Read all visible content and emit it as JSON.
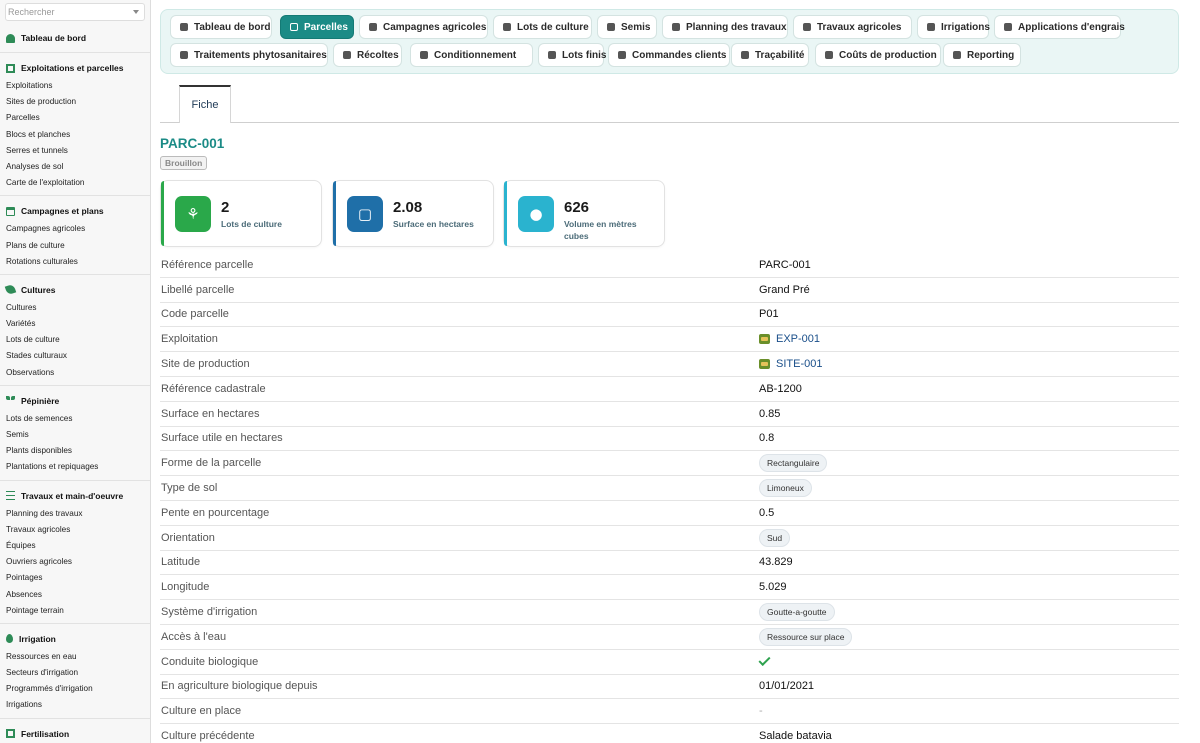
{
  "sidebar": {
    "search_placeholder": "Rechercher",
    "dashboard_label": "Tableau de bord",
    "groups": [
      {
        "title": "Exploitations et parcelles",
        "items": [
          "Exploitations",
          "Sites de production",
          "Parcelles",
          "Blocs et planches",
          "Serres et tunnels",
          "Analyses de sol",
          "Carte de l'exploitation"
        ]
      },
      {
        "title": "Campagnes et plans",
        "items": [
          "Campagnes agricoles",
          "Plans de culture",
          "Rotations culturales"
        ]
      },
      {
        "title": "Cultures",
        "items": [
          "Cultures",
          "Variétés",
          "Lots de culture",
          "Stades culturaux",
          "Observations"
        ]
      },
      {
        "title": "Pépinière",
        "items": [
          "Lots de semences",
          "Semis",
          "Plants disponibles",
          "Plantations et repiquages"
        ]
      },
      {
        "title": "Travaux et main-d'oeuvre",
        "items": [
          "Planning des travaux",
          "Travaux agricoles",
          "Équipes",
          "Ouvriers agricoles",
          "Pointages",
          "Absences",
          "Pointage terrain"
        ]
      },
      {
        "title": "Irrigation",
        "items": [
          "Ressources en eau",
          "Secteurs d'irrigation",
          "Programmés d'irrigation",
          "Irrigations"
        ]
      },
      {
        "title": "Fertilisation",
        "items": []
      }
    ]
  },
  "topnav": {
    "row1": [
      "Tableau de bord",
      "Parcelles",
      "Campagnes agricoles",
      "Lots de culture",
      "Semis",
      "Planning des travaux",
      "Travaux agricoles",
      "Irrigations",
      "Applications d'engrais"
    ],
    "row2": [
      "Traitements phytosanitaires",
      "Récoltes",
      "Conditionnement",
      "Lots finis",
      "Commandes clients",
      "Traçabilité",
      "Coûts de production",
      "Reporting"
    ],
    "active": "Parcelles"
  },
  "tab": {
    "label": "Fiche"
  },
  "record": {
    "title": "PARC-001",
    "status": "Brouillon"
  },
  "kpis": [
    {
      "value": "2",
      "label": "Lots de culture",
      "color": "#2aa84a",
      "icon": "sprout-icon"
    },
    {
      "value": "2.08",
      "label": "Surface en hectares",
      "color": "#1f6fa8",
      "icon": "area-icon"
    },
    {
      "value": "626",
      "label": "Volume en mètres cubes",
      "color": "#2ab3cf",
      "icon": "water-drop-icon"
    }
  ],
  "details": [
    {
      "key": "Référence parcelle",
      "value": "PARC-001",
      "type": "text"
    },
    {
      "key": "Libellé parcelle",
      "value": "Grand Pré",
      "type": "text"
    },
    {
      "key": "Code parcelle",
      "value": "P01",
      "type": "text"
    },
    {
      "key": "Exploitation",
      "value": "EXP-001",
      "type": "link"
    },
    {
      "key": "Site de production",
      "value": "SITE-001",
      "type": "link"
    },
    {
      "key": "Référence cadastrale",
      "value": "AB-1200",
      "type": "text"
    },
    {
      "key": "Surface en hectares",
      "value": "0.85",
      "type": "text"
    },
    {
      "key": "Surface utile en hectares",
      "value": "0.8",
      "type": "text"
    },
    {
      "key": "Forme de la parcelle",
      "value": "Rectangulaire",
      "type": "chip"
    },
    {
      "key": "Type de sol",
      "value": "Limoneux",
      "type": "chip"
    },
    {
      "key": "Pente en pourcentage",
      "value": "0.5",
      "type": "text"
    },
    {
      "key": "Orientation",
      "value": "Sud",
      "type": "chip"
    },
    {
      "key": "Latitude",
      "value": "43.829",
      "type": "text"
    },
    {
      "key": "Longitude",
      "value": "5.029",
      "type": "text"
    },
    {
      "key": "Système d'irrigation",
      "value": "Goutte-a-goutte",
      "type": "chip"
    },
    {
      "key": "Accès à l'eau",
      "value": "Ressource sur place",
      "type": "chip"
    },
    {
      "key": "Conduite biologique",
      "value": true,
      "type": "check"
    },
    {
      "key": "En agriculture biologique depuis",
      "value": "01/01/2021",
      "type": "text"
    },
    {
      "key": "Culture en place",
      "value": "-",
      "type": "muted"
    },
    {
      "key": "Culture précédente",
      "value": "Salade batavia",
      "type": "text"
    }
  ]
}
